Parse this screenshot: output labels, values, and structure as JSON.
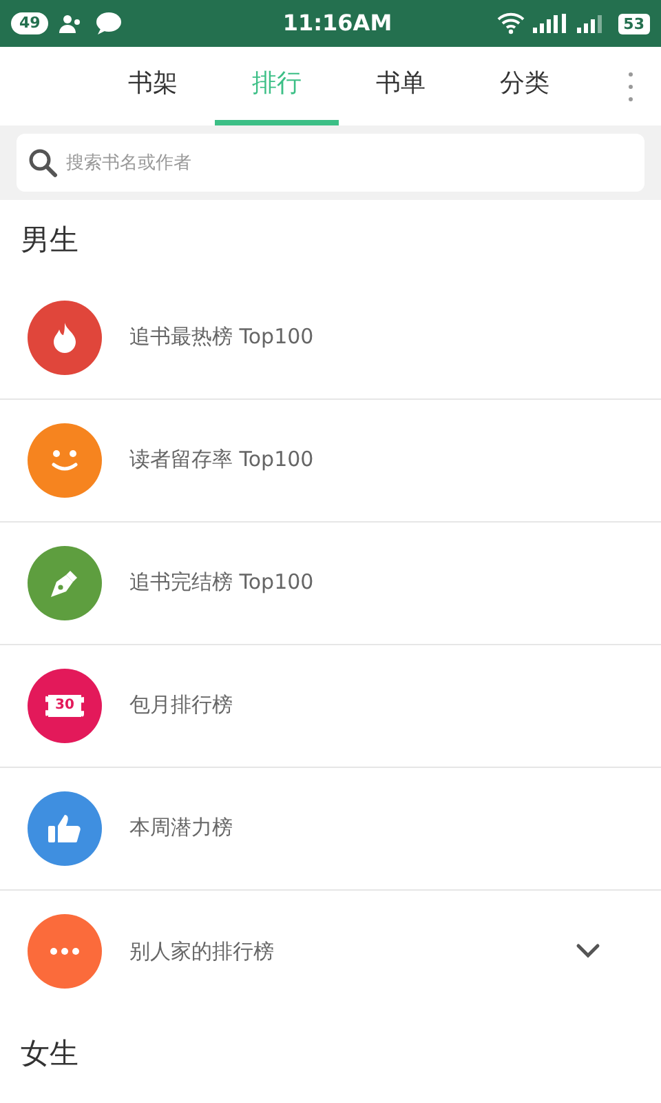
{
  "status_bar": {
    "notification_count": "49",
    "time": "11:16AM",
    "battery": "53"
  },
  "tabs": [
    {
      "label": "书架",
      "selected": false
    },
    {
      "label": "排行",
      "selected": true
    },
    {
      "label": "书单",
      "selected": false
    },
    {
      "label": "分类",
      "selected": false
    }
  ],
  "search": {
    "placeholder": "搜索书名或作者"
  },
  "sections": [
    {
      "title": "男生",
      "items": [
        {
          "kind": "flame",
          "label": "追书最热榜 Top100",
          "color": "#e0463b"
        },
        {
          "kind": "smile",
          "label": "读者留存率 Top100",
          "color": "#f6841f"
        },
        {
          "kind": "pen",
          "label": "追书完结榜 Top100",
          "color": "#5e9e3f"
        },
        {
          "kind": "ticket",
          "label": "包月排行榜",
          "color": "#e3195a",
          "icon_text": "30"
        },
        {
          "kind": "thumb",
          "label": "本周潜力榜",
          "color": "#3f8fe0"
        },
        {
          "kind": "more",
          "label": "别人家的排行榜",
          "color": "#fb6b3b",
          "expanded": false
        }
      ]
    },
    {
      "title": "女生"
    }
  ]
}
